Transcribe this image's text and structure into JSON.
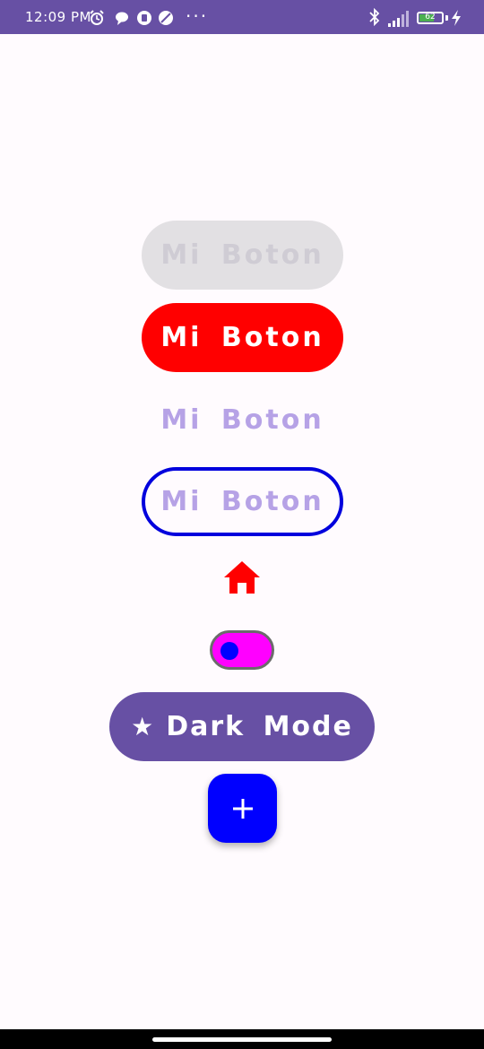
{
  "status_bar": {
    "time": "12:09 PM",
    "battery_level": "62",
    "background_color": "#6750a4",
    "icons": [
      "alarm-icon",
      "chat-icon",
      "app-icon",
      "no-sync-icon",
      "bluetooth-icon",
      "signal-icon",
      "battery-icon",
      "charging-icon"
    ]
  },
  "buttons": {
    "disabled_label": "Mi Boton",
    "filled_label": "Mi Boton",
    "text_label": "Mi Boton",
    "outlined_label": "Mi Boton",
    "dark_mode_label": "Dark Mode"
  },
  "switch": {
    "checked": false,
    "track_color": "#ff00ff",
    "thumb_color": "#0000ff"
  },
  "icons": {
    "home": "home-icon",
    "fab": "plus-icon",
    "dark_mode": "star-icon"
  },
  "colors": {
    "primary": "#6750a4",
    "red": "#ff0000",
    "blue": "#0000ff",
    "outline_blue": "#0000dd",
    "disabled_bg": "#e2e0e3",
    "label_lavender": "#b6a2e6"
  }
}
